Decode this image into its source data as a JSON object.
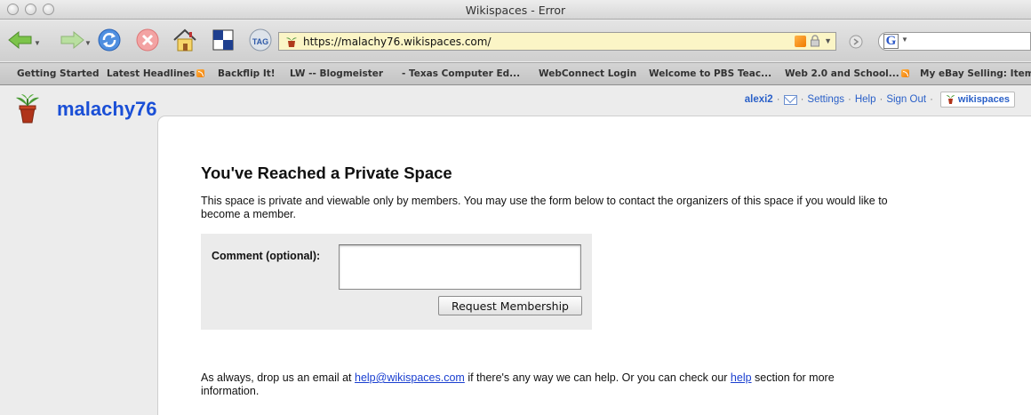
{
  "window": {
    "title": "Wikispaces - Error"
  },
  "toolbar": {
    "url": "https://malachy76.wikispaces.com/",
    "tag_label": "TAG",
    "icons": [
      "back-arrow-icon",
      "forward-arrow-icon",
      "reload-icon",
      "stop-icon",
      "home-icon",
      "window-icon",
      "tag-icon",
      "rss-feed-icon",
      "lock-icon",
      "go-icon",
      "google-search-icon"
    ],
    "search_engine_glyph": "G"
  },
  "bookmarks": [
    {
      "label": "Getting Started",
      "rss": false
    },
    {
      "label": "Latest Headlines",
      "rss": true
    },
    {
      "label": "Backflip It!",
      "rss": false
    },
    {
      "label": "LW -- Blogmeister",
      "rss": false
    },
    {
      "label": "- Texas Computer Ed...",
      "rss": false
    },
    {
      "label": "WebConnect Login",
      "rss": false
    },
    {
      "label": "Welcome to PBS Teac...",
      "rss": false
    },
    {
      "label": "Web 2.0 and School...",
      "rss": true
    },
    {
      "label": "My eBay Selling: Item",
      "rss": false
    }
  ],
  "site": {
    "name": "malachy76"
  },
  "usernav": {
    "username": "alexi2",
    "settings": "Settings",
    "help": "Help",
    "sign_out": "Sign Out",
    "brand": "wikispaces",
    "separator": "·"
  },
  "main": {
    "heading": "You've Reached a Private Space",
    "intro": "This space is private and viewable only by members. You may use the form below to contact the organizers of this space if you would like to become a member.",
    "form": {
      "comment_label": "Comment (optional):",
      "comment_value": "",
      "submit_label": "Request Membership"
    },
    "outro": {
      "part1": "As always, drop us an email at ",
      "email": "help@wikispaces.com",
      "part2": " if there's any way we can help. Or you can check our ",
      "help_link": "help",
      "part3": " section for more information."
    }
  },
  "colors": {
    "link": "#1a3fd0",
    "site_name": "#1a4fd6",
    "url_bar": "#fbf5c6"
  }
}
